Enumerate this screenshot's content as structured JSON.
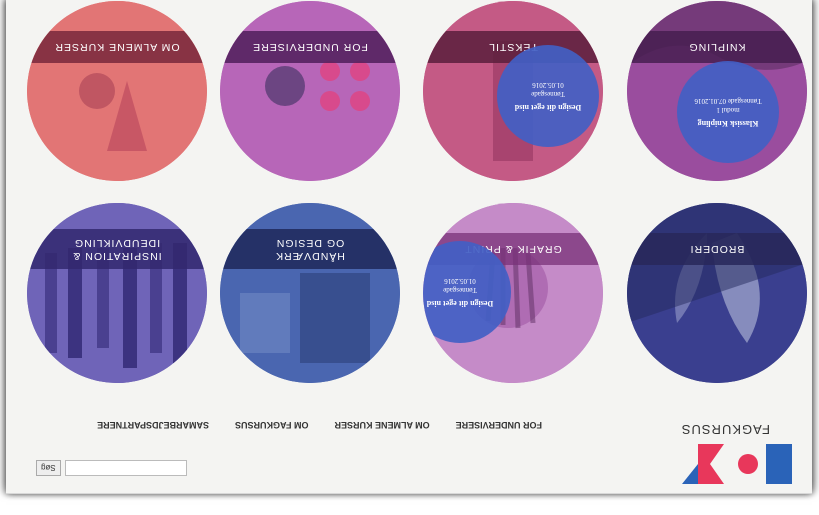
{
  "brand": {
    "name": "FAGKURSUS",
    "colors": {
      "pink": "#e8375b",
      "blue": "#2a63b8"
    }
  },
  "search": {
    "button_label": "Søg",
    "placeholder": ""
  },
  "nav": {
    "items": [
      {
        "label": "FOR UNDERVISERE"
      },
      {
        "label": "OM ALMENE KURSER"
      },
      {
        "label": "OM FAGKURSUS"
      },
      {
        "label": "SAMARBEJDSPARTNERE"
      }
    ]
  },
  "tiles": [
    {
      "label": "BRODERI",
      "color": "#3a3f8f",
      "icon": "butterfly-embroidery-photo"
    },
    {
      "label": "GRAFIK & PRINT",
      "color": "#b36fb8",
      "icon": "hand-print-photo",
      "badge": {
        "line1": "Design dit eget nisd",
        "line2": "Tønnesgade",
        "line3": "01.05.2016"
      }
    },
    {
      "label": "HÅNDVÆRK\nOG DESIGN",
      "color": "#3f5aa5",
      "icon": "woodwork-photo"
    },
    {
      "label": "INSPIRATION &\nIDEUDVIKLING",
      "color": "#5b4ea8",
      "icon": "textile-strips-photo"
    },
    {
      "label": "KNIPLING",
      "color": "#8a3e8e",
      "icon": "lace-photo",
      "badge": {
        "line1": "Klassisk Knipling",
        "line2": "modul 1",
        "line3": "Tønnesgade 07.01.2016"
      }
    },
    {
      "label": "TEKSTIL",
      "color": "#c0487a",
      "icon": "fabric-photo",
      "badge": {
        "line1": "Design dit eget nisd",
        "line2": "Tønnesgade",
        "line3": "01.05.2016"
      }
    },
    {
      "label": "FOR UNDERVISERE",
      "color": "#b05ab0",
      "icon": "classroom-photo"
    },
    {
      "label": "OM ALMENE KURSER",
      "color": "#e06a6a",
      "icon": "child-crafts-photo"
    }
  ]
}
